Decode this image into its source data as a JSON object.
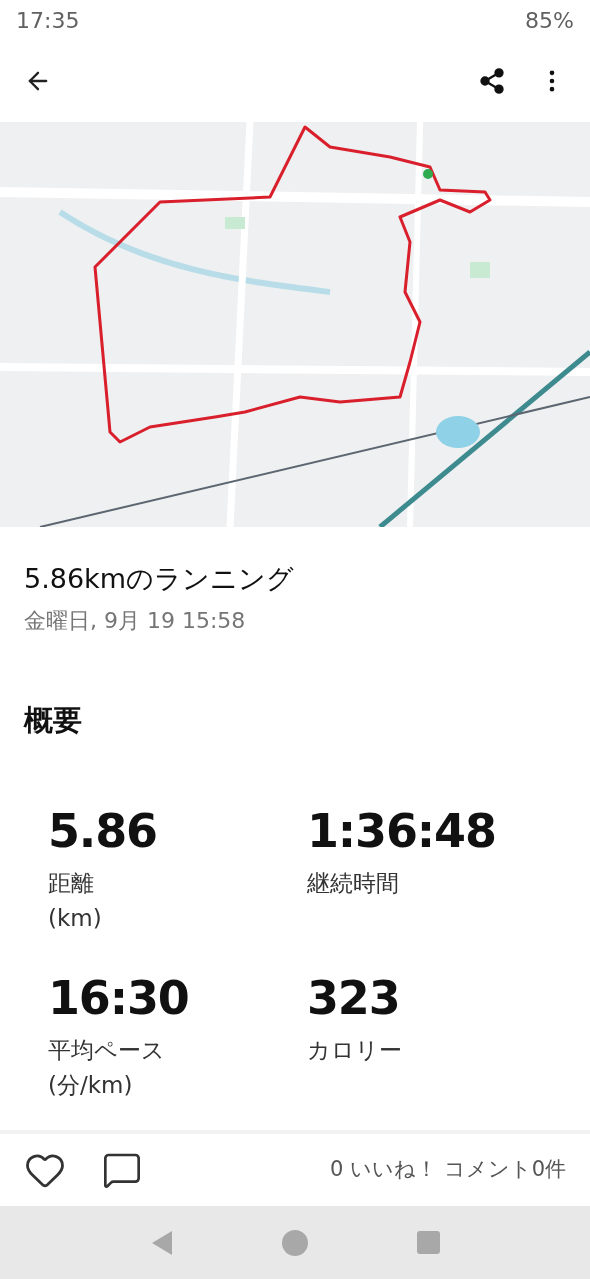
{
  "status_bar": {
    "time": "17:35",
    "battery": "85%"
  },
  "activity": {
    "title": "5.86kmのランニング",
    "date": "金曜日, 9月 19 15:58"
  },
  "summary": {
    "heading": "概要",
    "stats": [
      {
        "value": "5.86",
        "label": "距離",
        "unit": "(km)"
      },
      {
        "value": "1:36:48",
        "label": "継続時間"
      },
      {
        "value": "16:30",
        "label": "平均ペース",
        "unit": "(分/km)"
      },
      {
        "value": "323",
        "label": "カロリー"
      }
    ]
  },
  "social": {
    "summary": "0 いいね！ コメント0件"
  }
}
